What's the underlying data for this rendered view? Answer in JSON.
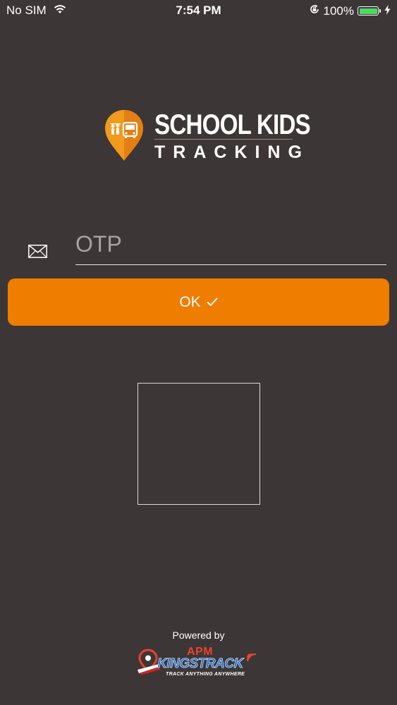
{
  "status_bar": {
    "carrier": "No SIM",
    "time": "7:54 PM",
    "battery_percent": "100%",
    "battery_level": 1.0,
    "battery_color": "#4cd964",
    "icons": [
      "wifi-icon",
      "orientation-lock-icon",
      "battery-icon",
      "charging-icon"
    ]
  },
  "logo": {
    "title": "SCHOOL KIDS",
    "subtitle": "TRACKING",
    "pin_color": "#f29a1c",
    "icon": "map-pin-bus-icon"
  },
  "otp": {
    "icon": "mail-icon",
    "placeholder": "OTP",
    "value": ""
  },
  "ok_button": {
    "label": "OK",
    "icon": "checkmark-icon",
    "color": "#ee7d00"
  },
  "footer": {
    "powered_by": "Powered by",
    "brand_apm": "APM",
    "brand_name": "KINGSTRACK",
    "brand_tagline": "TRACK ANYTHING ANYWHERE",
    "brand_color": "#1f6fd1",
    "accent_color": "#e8432e"
  },
  "colors": {
    "background": "#3d3636",
    "text": "#ffffff"
  }
}
